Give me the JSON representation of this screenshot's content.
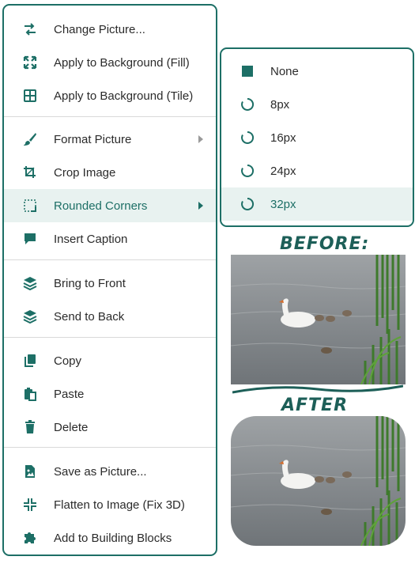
{
  "menu": {
    "items": [
      {
        "label": "Change Picture...",
        "icon": "swap-arrows-icon"
      },
      {
        "label": "Apply to Background (Fill)",
        "icon": "expand-arrows-icon"
      },
      {
        "label": "Apply to Background (Tile)",
        "icon": "grid-icon"
      },
      {
        "label": "Format Picture",
        "icon": "brush-icon"
      },
      {
        "label": "Crop Image",
        "icon": "crop-icon"
      },
      {
        "label": "Rounded Corners",
        "icon": "rounded-corner-icon"
      },
      {
        "label": "Insert Caption",
        "icon": "speech-bubble-icon"
      },
      {
        "label": "Bring to Front",
        "icon": "layers-icon"
      },
      {
        "label": "Send to Back",
        "icon": "layers-icon"
      },
      {
        "label": "Copy",
        "icon": "copy-icon"
      },
      {
        "label": "Paste",
        "icon": "paste-icon"
      },
      {
        "label": "Delete",
        "icon": "trash-icon"
      },
      {
        "label": "Save as Picture...",
        "icon": "image-file-icon"
      },
      {
        "label": "Flatten to Image (Fix 3D)",
        "icon": "collapse-arrows-icon"
      },
      {
        "label": "Add to Building Blocks",
        "icon": "puzzle-icon"
      }
    ]
  },
  "submenu": {
    "items": [
      {
        "label": "None"
      },
      {
        "label": "8px"
      },
      {
        "label": "16px"
      },
      {
        "label": "24px"
      },
      {
        "label": "32px"
      }
    ],
    "selected": "32px"
  },
  "preview": {
    "before_label": "BEFORE:",
    "after_label": "AFTER"
  },
  "colors": {
    "accent": "#1d6f66",
    "highlight": "#e8f2f0"
  }
}
